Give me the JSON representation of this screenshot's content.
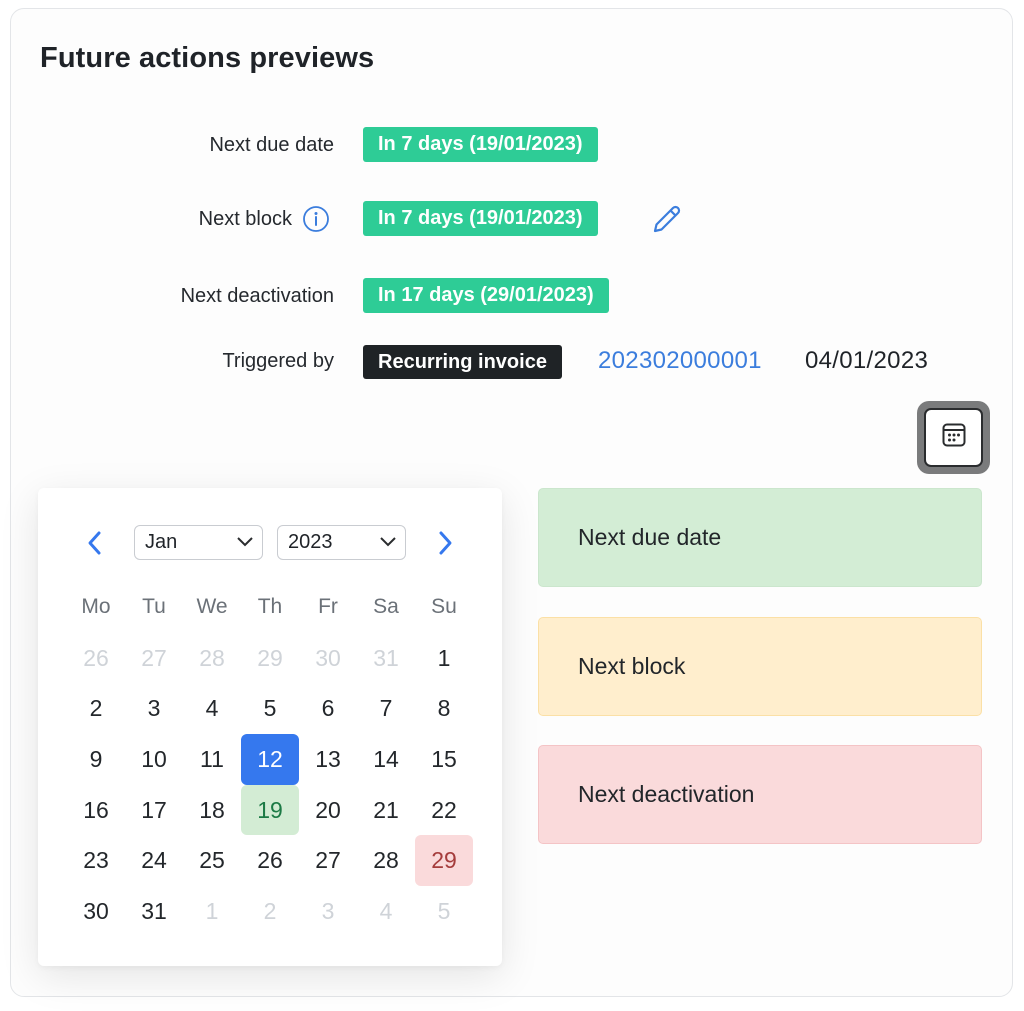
{
  "title": "Future actions previews",
  "rows": {
    "next_due_date": {
      "label": "Next due date",
      "value": "In 7 days (19/01/2023)"
    },
    "next_block": {
      "label": "Next block",
      "value": "In 7 days (19/01/2023)",
      "info_icon": "info-icon",
      "edit_icon": "pencil-icon"
    },
    "next_deactivation": {
      "label": "Next deactivation",
      "value": "In 17 days (29/01/2023)"
    },
    "triggered_by": {
      "label": "Triggered by",
      "badge": "Recurring invoice",
      "link": "202302000001",
      "date": "04/01/2023"
    }
  },
  "calendar_toggle": {
    "icon": "calendar-icon"
  },
  "calendar": {
    "prev_icon": "chevron-left-icon",
    "next_icon": "chevron-right-icon",
    "month": "Jan",
    "year": "2023",
    "weekdays": [
      "Mo",
      "Tu",
      "We",
      "Th",
      "Fr",
      "Sa",
      "Su"
    ],
    "days": [
      {
        "d": "26",
        "type": "muted"
      },
      {
        "d": "27",
        "type": "muted"
      },
      {
        "d": "28",
        "type": "muted"
      },
      {
        "d": "29",
        "type": "muted"
      },
      {
        "d": "30",
        "type": "muted"
      },
      {
        "d": "31",
        "type": "muted"
      },
      {
        "d": "1",
        "type": ""
      },
      {
        "d": "2",
        "type": ""
      },
      {
        "d": "3",
        "type": ""
      },
      {
        "d": "4",
        "type": ""
      },
      {
        "d": "5",
        "type": ""
      },
      {
        "d": "6",
        "type": ""
      },
      {
        "d": "7",
        "type": ""
      },
      {
        "d": "8",
        "type": ""
      },
      {
        "d": "9",
        "type": ""
      },
      {
        "d": "10",
        "type": ""
      },
      {
        "d": "11",
        "type": ""
      },
      {
        "d": "12",
        "type": "selected"
      },
      {
        "d": "13",
        "type": ""
      },
      {
        "d": "14",
        "type": ""
      },
      {
        "d": "15",
        "type": ""
      },
      {
        "d": "16",
        "type": ""
      },
      {
        "d": "17",
        "type": ""
      },
      {
        "d": "18",
        "type": ""
      },
      {
        "d": "19",
        "type": "due"
      },
      {
        "d": "20",
        "type": ""
      },
      {
        "d": "21",
        "type": ""
      },
      {
        "d": "22",
        "type": ""
      },
      {
        "d": "23",
        "type": ""
      },
      {
        "d": "24",
        "type": ""
      },
      {
        "d": "25",
        "type": ""
      },
      {
        "d": "26",
        "type": ""
      },
      {
        "d": "27",
        "type": ""
      },
      {
        "d": "28",
        "type": ""
      },
      {
        "d": "29",
        "type": "deact"
      },
      {
        "d": "30",
        "type": ""
      },
      {
        "d": "31",
        "type": ""
      },
      {
        "d": "1",
        "type": "muted"
      },
      {
        "d": "2",
        "type": "muted"
      },
      {
        "d": "3",
        "type": "muted"
      },
      {
        "d": "4",
        "type": "muted"
      },
      {
        "d": "5",
        "type": "muted"
      }
    ]
  },
  "legend": [
    {
      "label": "Next due date",
      "color": "#d3edd5"
    },
    {
      "label": "Next block",
      "color": "#ffeecd"
    },
    {
      "label": "Next deactivation",
      "color": "#fadadb"
    }
  ],
  "colors": {
    "badge_green": "#2ecc96",
    "badge_dark": "#1f2326",
    "link_blue": "#3b7ddd",
    "selected_day": "#3578ee"
  }
}
